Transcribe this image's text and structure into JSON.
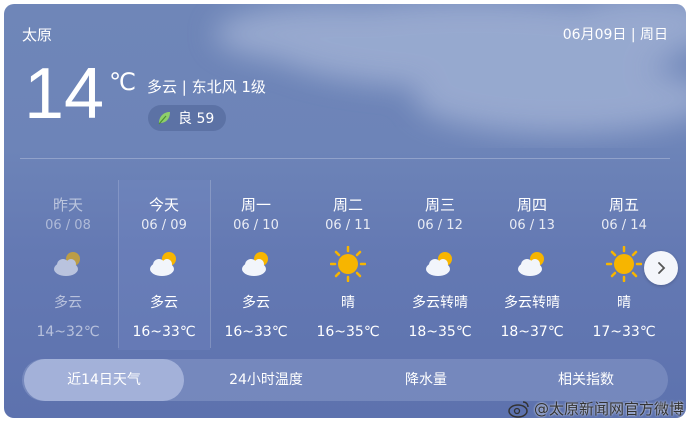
{
  "header": {
    "city": "太原",
    "date": "06月09日 | 周日"
  },
  "current": {
    "temp": "14",
    "unit": "℃",
    "condition": "多云 | 东北风 1级",
    "aqi_label": "良 59",
    "aqi_icon": "leaf-icon"
  },
  "days": [
    {
      "name": "昨天",
      "date": "06 / 08",
      "weather": "多云",
      "range": "14~32℃",
      "icon": "partly-cloudy-icon"
    },
    {
      "name": "今天",
      "date": "06 / 09",
      "weather": "多云",
      "range": "16~33℃",
      "icon": "partly-cloudy-icon"
    },
    {
      "name": "周一",
      "date": "06 / 10",
      "weather": "多云",
      "range": "16~33℃",
      "icon": "partly-cloudy-icon"
    },
    {
      "name": "周二",
      "date": "06 / 11",
      "weather": "晴",
      "range": "16~35℃",
      "icon": "sun-icon"
    },
    {
      "name": "周三",
      "date": "06 / 12",
      "weather": "多云转晴",
      "range": "18~35℃",
      "icon": "partly-cloudy-icon"
    },
    {
      "name": "周四",
      "date": "06 / 13",
      "weather": "多云转晴",
      "range": "18~37℃",
      "icon": "partly-cloudy-icon"
    },
    {
      "name": "周五",
      "date": "06 / 14",
      "weather": "晴",
      "range": "17~33℃",
      "icon": "sun-icon"
    }
  ],
  "tabs": [
    "近14日天气",
    "24小时温度",
    "降水量",
    "相关指数"
  ],
  "watermark": "@太原新闻网官方微博",
  "colors": {
    "sun": "#f7b500",
    "cloud": "#f2f5fb",
    "card": "#6d84b8"
  }
}
